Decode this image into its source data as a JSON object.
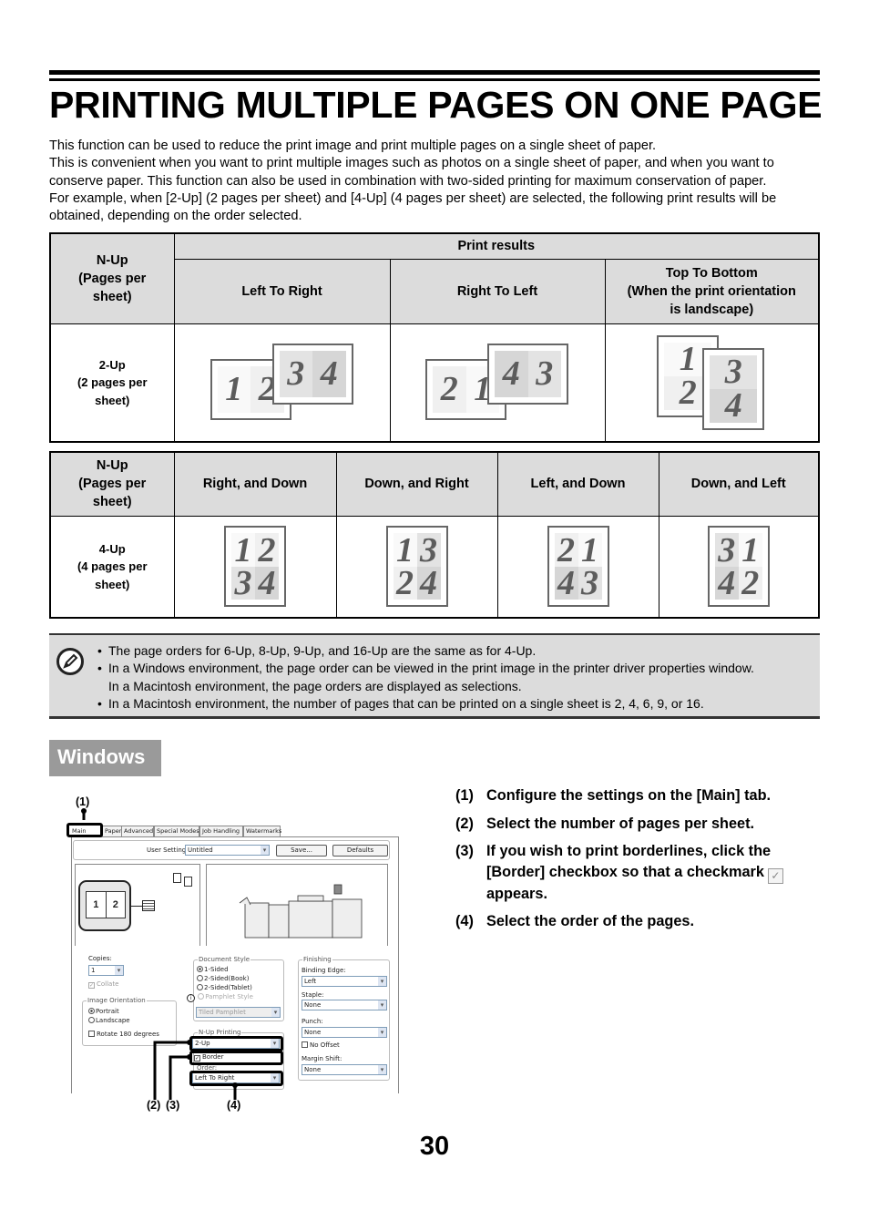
{
  "title": "PRINTING MULTIPLE PAGES ON ONE PAGE",
  "intro": [
    "This function can be used to reduce the print image and print multiple pages on a single sheet of paper.",
    "This is convenient when you want to print multiple images such as photos on a single sheet of paper, and when you want to conserve paper. This function can also be used in combination with two-sided printing for maximum conservation of paper.",
    "For example, when [2-Up] (2 pages per sheet) and [4-Up] (4 pages per sheet) are selected, the following print results will be obtained, depending on the order selected."
  ],
  "table1": {
    "nup_header": [
      "N-Up",
      "(Pages per",
      "sheet)"
    ],
    "print_results": "Print results",
    "columns": [
      "Left To Right",
      "Right To Left",
      [
        "Top To Bottom",
        "(When the print orientation",
        "is landscape)"
      ]
    ],
    "row_label": [
      "2-Up",
      "(2 pages per",
      "sheet)"
    ],
    "illustrations": [
      {
        "orientation": "landscape",
        "sheets": [
          [
            "1",
            "2"
          ],
          [
            "3",
            "4"
          ]
        ]
      },
      {
        "orientation": "landscape",
        "sheets": [
          [
            "2",
            "1"
          ],
          [
            "4",
            "3"
          ]
        ]
      },
      {
        "orientation": "portrait",
        "sheets": [
          [
            "1",
            "2"
          ],
          [
            "3",
            "4"
          ]
        ]
      }
    ]
  },
  "table2": {
    "nup_header": [
      "N-Up",
      "(Pages per",
      "sheet)"
    ],
    "columns": [
      "Right, and Down",
      "Down, and Right",
      "Left, and Down",
      "Down, and Left"
    ],
    "row_label": [
      "4-Up",
      "(4 pages per",
      "sheet)"
    ],
    "illustrations": [
      [
        [
          "1",
          "2"
        ],
        [
          "3",
          "4"
        ]
      ],
      [
        [
          "1",
          "3"
        ],
        [
          "2",
          "4"
        ]
      ],
      [
        [
          "2",
          "1"
        ],
        [
          "4",
          "3"
        ]
      ],
      [
        [
          "3",
          "1"
        ],
        [
          "4",
          "2"
        ]
      ]
    ]
  },
  "note": {
    "icon": "pencil-icon",
    "items": [
      [
        "The page orders for 6-Up, 8-Up, 9-Up, and 16-Up are the same as for 4-Up."
      ],
      [
        "In a Windows environment, the page order can be viewed in the print image in the printer driver properties window.",
        "In a Macintosh environment, the page orders are displayed as selections."
      ],
      [
        "In a Macintosh environment, the number of pages that can be printed on a single sheet is 2, 4, 6, 9, or 16."
      ]
    ]
  },
  "windows_heading": "Windows",
  "steps": [
    {
      "num": "(1)",
      "text": "Configure the settings on the [Main] tab."
    },
    {
      "num": "(2)",
      "text": "Select the number of pages per sheet."
    },
    {
      "num": "(3)",
      "text": "If you wish to print borderlines, click the [Border] checkbox so that a checkmark",
      "after": "appears."
    },
    {
      "num": "(4)",
      "text": "Select the order of the pages."
    }
  ],
  "dialog": {
    "tabs": [
      "Main",
      "Paper",
      "Advanced",
      "Special Modes",
      "Job Handling",
      "Watermarks"
    ],
    "user_settings_label": "User Settings:",
    "user_settings_value": "Untitled",
    "save": "Save...",
    "defaults": "Defaults",
    "preview_pages": [
      "1",
      "2"
    ],
    "copies_label": "Copies:",
    "copies_value": "1",
    "collate": "Collate",
    "image_orientation": "Image Orientation",
    "portrait": "Portrait",
    "landscape": "Landscape",
    "rotate": "Rotate 180 degrees",
    "document_style": "Document Style",
    "sided1": "1-Sided",
    "sided2_book": "2-Sided(Book)",
    "sided2_tablet": "2-Sided(Tablet)",
    "pamphlet": "Pamphlet Style",
    "tiled_pamphlet": "Tiled Pamphlet",
    "nup_printing": "N-Up Printing",
    "nup_value": "2-Up",
    "border": "Border",
    "order_label": "Order:",
    "order_value": "Left To Right",
    "finishing": "Finishing",
    "binding_edge": "Binding Edge:",
    "binding_value": "Left",
    "staple": "Staple:",
    "staple_value": "None",
    "punch": "Punch:",
    "punch_value": "None",
    "no_offset": "No Offset",
    "margin_shift": "Margin Shift:",
    "margin_value": "None"
  },
  "callouts": [
    "(1)",
    "(2)",
    "(3)",
    "(4)"
  ],
  "page_number": "30"
}
